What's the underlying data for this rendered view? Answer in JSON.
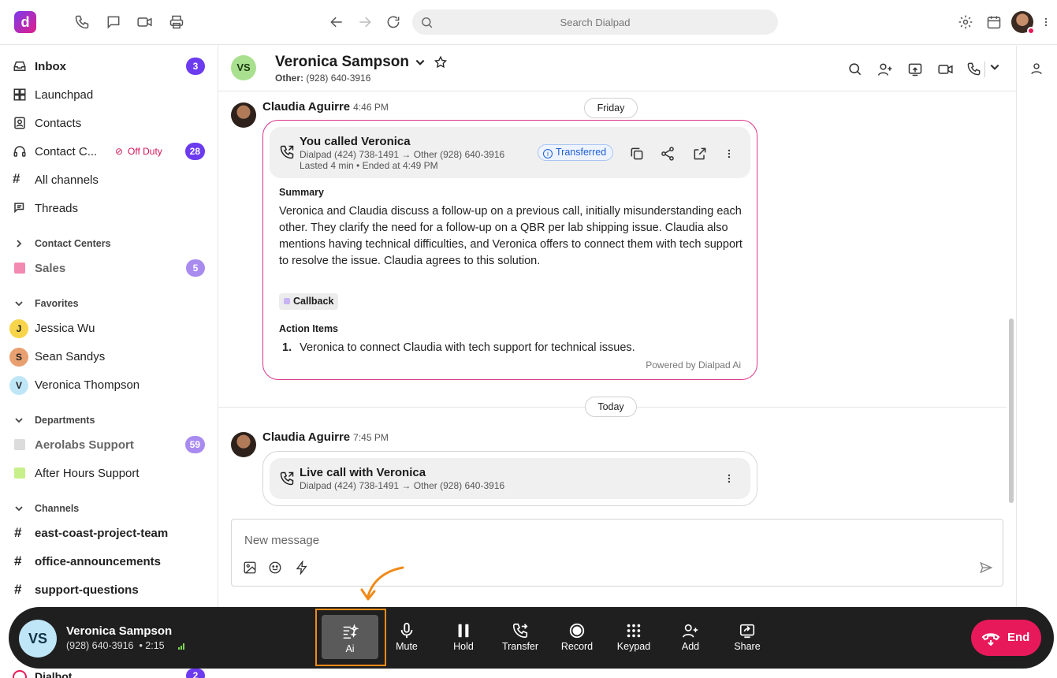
{
  "search": {
    "placeholder": "Search Dialpad"
  },
  "app": {
    "logo_letter": "d"
  },
  "me": {
    "avatar_alt": "avatar"
  },
  "sidebar": {
    "items": [
      {
        "label": "Inbox",
        "badge": "3",
        "icon": "inbox-icon"
      },
      {
        "label": "Launchpad",
        "icon": "launchpad-icon"
      },
      {
        "label": "Contacts",
        "icon": "contacts-icon"
      },
      {
        "label": "Contact C...",
        "status": "Off Duty",
        "badge": "28",
        "icon": "headset-icon"
      },
      {
        "label": "All channels",
        "icon": "hash-icon"
      },
      {
        "label": "Threads",
        "icon": "threads-icon"
      }
    ],
    "contact_centers": {
      "header": "Contact Centers",
      "items": [
        {
          "label": "Sales",
          "badge": "5",
          "color": "#f28ab2"
        }
      ]
    },
    "favorites": {
      "header": "Favorites",
      "items": [
        {
          "initial": "J",
          "label": "Jessica Wu",
          "color": "#f7d44a"
        },
        {
          "initial": "S",
          "label": "Sean Sandys",
          "color": "#e8a070"
        },
        {
          "initial": "V",
          "label": "Veronica Thompson",
          "color": "#bfe6f7"
        }
      ]
    },
    "departments": {
      "header": "Departments",
      "items": [
        {
          "label": "Aerolabs Support",
          "badge": "59",
          "color": "#d9d9d9"
        },
        {
          "label": "After Hours Support",
          "color": "#c7f08a"
        }
      ]
    },
    "channels": {
      "header": "Channels",
      "items": [
        {
          "label": "east-coast-project-team"
        },
        {
          "label": "office-announcements"
        },
        {
          "label": "support-questions"
        }
      ]
    },
    "peek": {
      "label": "Dialbot",
      "badge": "2"
    }
  },
  "conversation": {
    "initials": "VS",
    "name": "Veronica Sampson",
    "sub_label": "Other:",
    "sub_number": "(928) 640-3916",
    "dates": [
      "Friday",
      "Today"
    ],
    "messages": [
      {
        "author": "Claudia Aguirre",
        "time": "4:46 PM",
        "call_title": "You called Veronica",
        "call_route": "Dialpad (424) 738-1491 → Other (928) 640-3916",
        "call_meta": "Lasted 4 min • Ended at 4:49 PM",
        "status": "Transferred",
        "summary_header": "Summary",
        "summary": "Veronica and Claudia discuss a follow-up on a previous call, initially misunderstanding each other. They clarify the need for a follow-up on a QBR per lab shipping issue. Claudia also mentions having technical difficulties, and Veronica offers to connect them with tech support to resolve the issue. Claudia agrees to this solution.",
        "tag": "Callback",
        "action_header": "Action Items",
        "action_number": "1.",
        "action_item": "Veronica to connect Claudia with tech support for technical issues.",
        "powered": "Powered by Dialpad Ai"
      },
      {
        "author": "Claudia Aguirre",
        "time": "7:45 PM",
        "call_title": "Live call with Veronica",
        "call_route": "Dialpad (424) 738-1491 → Other (928) 640-3916"
      }
    ]
  },
  "composer": {
    "placeholder": "New message"
  },
  "callbar": {
    "initials": "VS",
    "name": "Veronica Sampson",
    "number": "(928) 640-3916",
    "duration": "• 2:15",
    "controls": [
      "Ai",
      "Mute",
      "Hold",
      "Transfer",
      "Record",
      "Keypad",
      "Add",
      "Share"
    ],
    "end_label": "End"
  },
  "colors": {
    "accent": "#6c3bf0",
    "end": "#e8195a",
    "highlight": "#f08a18",
    "ai_border": "#d9368a"
  }
}
